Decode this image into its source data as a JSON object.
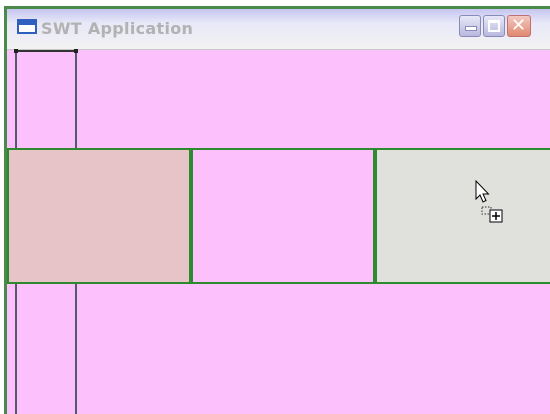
{
  "window": {
    "title": "SWT Application",
    "controls": {
      "minimize": "minimize-icon",
      "maximize": "maximize-icon",
      "close": "close-icon"
    }
  },
  "layout_cells": [
    {
      "name": "cell-1",
      "color": "#e6c4c8"
    },
    {
      "name": "cell-2",
      "color": "#fcc0fc"
    },
    {
      "name": "cell-3",
      "color": "#e0e0dc"
    }
  ],
  "colors": {
    "background": "#fcc0fc",
    "border": "#2e8a2e"
  },
  "cursor": {
    "icon": "drag-copy-cursor-icon"
  }
}
